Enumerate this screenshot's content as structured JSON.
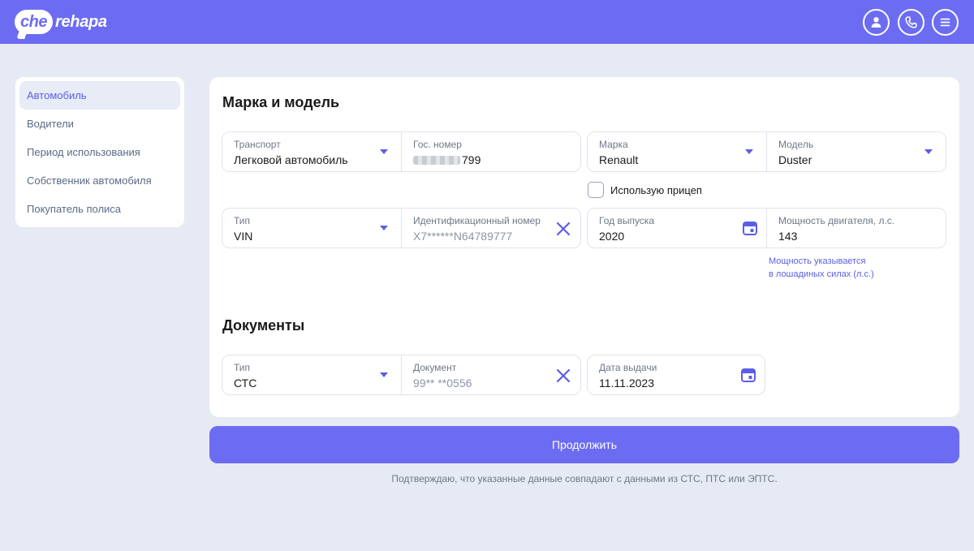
{
  "header": {
    "logo_bubble": "che",
    "logo_rest": "rehapa",
    "profile_icon": "user-icon",
    "phone_icon": "phone-icon",
    "menu_icon": "menu-icon"
  },
  "sidebar": {
    "items": [
      {
        "label": "Автомобиль",
        "active": true
      },
      {
        "label": "Водители"
      },
      {
        "label": "Период использования"
      },
      {
        "label": "Собственник автомобиля"
      },
      {
        "label": "Покупатель полиса"
      }
    ]
  },
  "vehicle": {
    "title": "Марка и модель",
    "transport": {
      "label": "Транспорт",
      "value": "Легковой автомобиль"
    },
    "plate": {
      "label": "Гос. номер",
      "value": "799"
    },
    "brand": {
      "label": "Марка",
      "value": "Renault"
    },
    "model": {
      "label": "Модель",
      "value": "Duster"
    },
    "trailer_label": "Использую прицеп",
    "id_type": {
      "label": "Тип",
      "value": "VIN"
    },
    "id_number": {
      "label": "Идентификационный номер",
      "value": "X7******N64789777"
    },
    "year": {
      "label": "Год выпуска",
      "value": "2020"
    },
    "power": {
      "label": "Мощность двигателя, л.с.",
      "value": "143"
    },
    "power_hint_line1": "Мощность указывается",
    "power_hint_line2": "в лошадиных силах (л.с.)"
  },
  "documents": {
    "title": "Документы",
    "doc_type": {
      "label": "Тип",
      "value": "СТС"
    },
    "doc_number": {
      "label": "Документ",
      "value": "99** **0556"
    },
    "issue_date": {
      "label": "Дата выдачи",
      "value": "11.11.2023"
    }
  },
  "continue_label": "Продолжить",
  "confirm_text": "Подтверждаю, что указанные данные совпадают с данными из СТС, ПТС или ЭПТС.",
  "colors": {
    "accent": "#6c6cf3",
    "background": "#e6eaf4"
  }
}
